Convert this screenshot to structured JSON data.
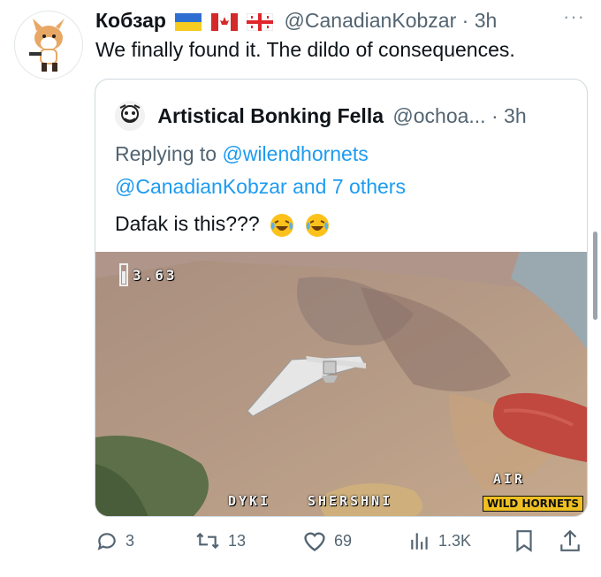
{
  "tweet": {
    "author_name": "Кобзар",
    "handle": "@CanadianKobzar",
    "separator": "·",
    "time": "3h",
    "text": "We finally found it. The dildo of consequences.",
    "more_label": "···"
  },
  "quote": {
    "author_name": "Artistical Bonking Fella",
    "handle": "@ochoa...",
    "separator": "·",
    "time": "3h",
    "replying_prefix": "Replying to",
    "replying_to": "@wilendhornets",
    "others_handle": "@CanadianKobzar",
    "others_text": "and 7 others",
    "text": "Dafak is this???",
    "video": {
      "osd_top": "3.63",
      "osd_air": "AIR",
      "osd_bottom_left": "DYKI",
      "osd_bottom_right": "SHERSHNI",
      "badge": "WILD HORNETS"
    }
  },
  "actions": {
    "replies": "3",
    "reposts": "13",
    "likes": "69",
    "views": "1.3K"
  },
  "colors": {
    "link": "#1d9bf0",
    "secondary_text": "#536471",
    "border": "#cfd9de"
  }
}
